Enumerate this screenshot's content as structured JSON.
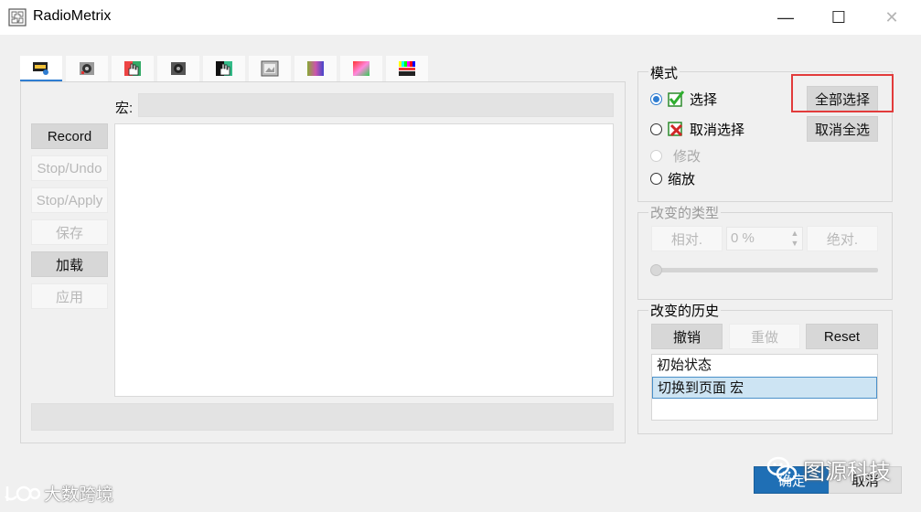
{
  "window": {
    "title": "RadioMetrix",
    "minimize_glyph": "—",
    "maximize_glyph": "☐",
    "close_glyph": "✕"
  },
  "tabs": [
    {
      "icon": "camera-record-icon",
      "active": true
    },
    {
      "icon": "gear-settings-icon",
      "active": false
    },
    {
      "icon": "hand-color-icon",
      "active": false
    },
    {
      "icon": "gear-dark-icon",
      "active": false
    },
    {
      "icon": "hand-gradient-icon",
      "active": false
    },
    {
      "icon": "image-preview-icon",
      "active": false
    },
    {
      "icon": "gradient-strip-icon",
      "active": false
    },
    {
      "icon": "color-square-icon",
      "active": false
    },
    {
      "icon": "color-bars-icon",
      "active": false
    }
  ],
  "macro": {
    "label": "宏:",
    "value": "",
    "editor_text": ""
  },
  "left_buttons": {
    "record": "Record",
    "stop_undo": "Stop/Undo",
    "stop_apply": "Stop/Apply",
    "save": "保存",
    "load": "加载",
    "apply": "应用"
  },
  "mode": {
    "title": "模式",
    "select": "选择",
    "deselect": "取消选择",
    "modify": "修改",
    "scale": "缩放",
    "select_all": "全部选择",
    "deselect_all": "取消全选",
    "selected_option": "选择"
  },
  "change_type": {
    "title": "改变的类型",
    "relative": "相对.",
    "percent_value": "0 %",
    "absolute": "绝对.",
    "slider_value": 0
  },
  "history": {
    "title": "改变的历史",
    "undo": "撤销",
    "redo": "重做",
    "reset": "Reset",
    "items": [
      "初始状态",
      "切换到页面 宏"
    ],
    "selected_index": 1
  },
  "footer": {
    "ok": "确定",
    "cancel": "取消"
  },
  "watermarks": {
    "left": "大数跨境",
    "right": "图源科技"
  },
  "colors": {
    "accent": "#2f7dd1",
    "highlight": "#e23b3b",
    "ok_button": "#1f6fb5"
  }
}
